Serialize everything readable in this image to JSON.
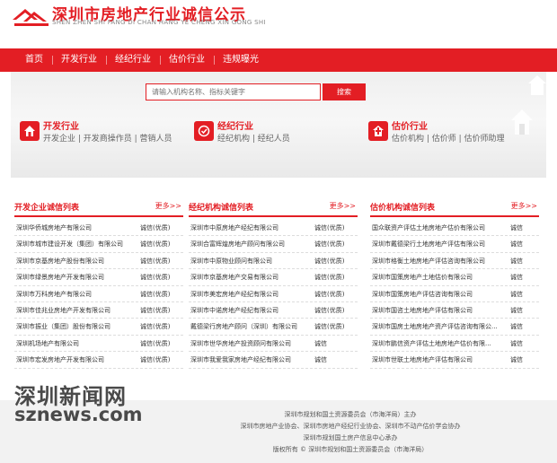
{
  "header": {
    "title": "深圳市房地产行业诚信公示",
    "pinyin": "SHEN ZHEN SHI FANG DI CHAN HANG YE CHENG XIN GONG SHI"
  },
  "nav": {
    "items": [
      "首页",
      "开发行业",
      "经纪行业",
      "估价行业",
      "违规曝光"
    ]
  },
  "search": {
    "placeholder": "请输入机构名称、指标关键字",
    "button": "搜索"
  },
  "categories": [
    {
      "title": "开发行业",
      "subtitle": "开发企业 | 开发商操作员 | 营销人员",
      "icon": "building-icon"
    },
    {
      "title": "经纪行业",
      "subtitle": "经纪机构 | 经纪人员",
      "icon": "badge-icon"
    },
    {
      "title": "估价行业",
      "subtitle": "估价机构 | 估价师 | 估价师助理",
      "icon": "home-icon"
    }
  ],
  "lists": [
    {
      "title": "开发企业诚信列表",
      "more": "更多>>",
      "rows": [
        {
          "name": "深圳华侨城房地产有限公司",
          "tag": "诚信(优质)"
        },
        {
          "name": "深圳市城市建设开发（集团）有限公司",
          "tag": "诚信(优质)"
        },
        {
          "name": "深圳市京基房地产股份有限公司",
          "tag": "诚信(优质)"
        },
        {
          "name": "深圳市绿景房地产开发有限公司",
          "tag": "诚信(优质)"
        },
        {
          "name": "深圳市万科房地产有限公司",
          "tag": "诚信(优质)"
        },
        {
          "name": "深圳市佳兆业房地产开发有限公司",
          "tag": "诚信(优质)"
        },
        {
          "name": "深圳市振业（集团）股份有限公司",
          "tag": "诚信(优质)"
        },
        {
          "name": "深圳机场地产有限公司",
          "tag": "诚信(优质)"
        },
        {
          "name": "深圳市宏发房地产开发有限公司",
          "tag": "诚信(优质)"
        }
      ]
    },
    {
      "title": "经纪机构诚信列表",
      "more": "更多>>",
      "rows": [
        {
          "name": "深圳市中原房地产经纪有限公司",
          "tag": "诚信(优质)"
        },
        {
          "name": "深圳合富辉煌房地产顾问有限公司",
          "tag": "诚信(优质)"
        },
        {
          "name": "深圳市中原物业顾问有限公司",
          "tag": "诚信(优质)"
        },
        {
          "name": "深圳市京基房地产交易有限公司",
          "tag": "诚信(优质)"
        },
        {
          "name": "深圳市美宏房地产经纪有限公司",
          "tag": "诚信(优质)"
        },
        {
          "name": "深圳市中诺房地产经纪有限公司",
          "tag": "诚信(优质)"
        },
        {
          "name": "戴德梁行房地产顾问（深圳）有限公司",
          "tag": "诚信(优质)"
        },
        {
          "name": "深圳市世华房地产投资顾问有限公司",
          "tag": "诚信"
        },
        {
          "name": "深圳市我爱我家房地产经纪有限公司",
          "tag": "诚信"
        }
      ]
    },
    {
      "title": "估价机构诚信列表",
      "more": "更多>>",
      "rows": [
        {
          "name": "国众联资产评估土地房地产估价有限公司",
          "tag": "诚信"
        },
        {
          "name": "深圳市戴德梁行土地房地产评估有限公司",
          "tag": "诚信"
        },
        {
          "name": "深圳市格衡土地房地产评估咨询有限公司",
          "tag": "诚信"
        },
        {
          "name": "深圳市国策房地产土地估价有限公司",
          "tag": "诚信"
        },
        {
          "name": "深圳市国策房地产评估咨询有限公司",
          "tag": "诚信"
        },
        {
          "name": "深圳市国咨土地房地产评估有限公司",
          "tag": "诚信"
        },
        {
          "name": "深圳市国房土地房地产资产评估咨询有限公...",
          "tag": "诚信"
        },
        {
          "name": "深圳市鹏信资产评估土地房地产估价有限...",
          "tag": "诚信"
        },
        {
          "name": "深圳市世联土地房地产评估有限公司",
          "tag": "诚信"
        }
      ]
    }
  ],
  "footer": {
    "line1": "深圳市规划和国土资源委员会（市海洋局）主办",
    "line2": "深圳市房地产业协会、深圳市房地产经纪行业协会、深圳市不动产估价学会协办",
    "line3": "深圳市规划国土房产信息中心承办",
    "line4": "版权所有 © 深圳市规划和国土资源委员会（市海洋局）"
  },
  "watermark": {
    "cn": "深圳新闻网",
    "en": "sznews.com"
  },
  "colors": {
    "accent": "#e31e24",
    "footer_bg": "#f2f2f2"
  }
}
